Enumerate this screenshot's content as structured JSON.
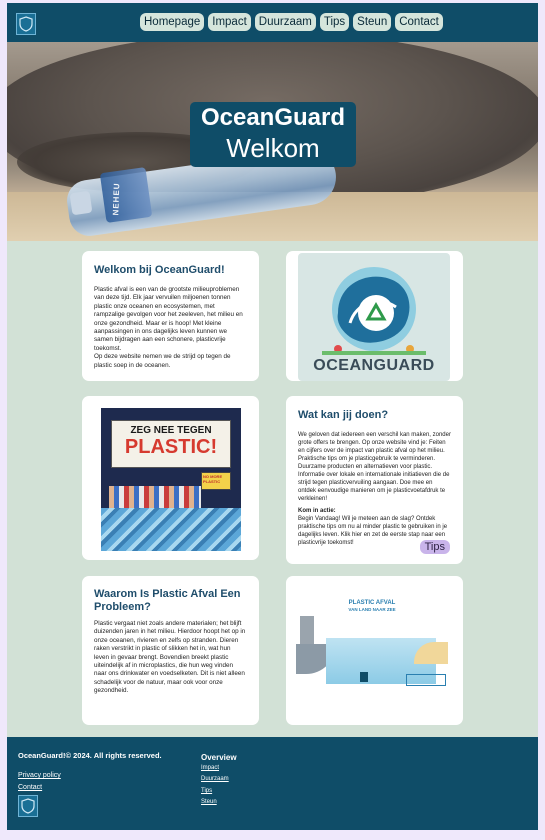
{
  "nav": {
    "logo_icon": "shield-icon",
    "items": [
      "Homepage",
      "Impact",
      "Duurzaam",
      "Tips",
      "Steun",
      "Contact"
    ]
  },
  "hero": {
    "title": "OceanGuard",
    "subtitle": "Welkom",
    "bottle_text": "NEHEU"
  },
  "card1": {
    "title": "Welkom bij OceanGuard!",
    "body": "Plastic afval is een van de grootste milieuproblemen van deze tijd. Elk jaar vervuilen miljoenen tonnen plastic onze oceanen en ecosystemen, met rampzalige gevolgen voor het zeeleven, het milieu en onze gezondheid. Maar er is hoop! Met kleine aanpassingen in ons dagelijks leven kunnen we samen bijdragen aan een schonere, plasticvrije toekomst.",
    "body2": "Op deze website nemen we de strijd op tegen de plastic soep in de oceanen."
  },
  "logo_image": {
    "text": "OCEANGUARD"
  },
  "poster": {
    "line1": "ZEG NEE TEGEN",
    "line2": "PLASTIC!",
    "sign": "NO MORE PLASTIC"
  },
  "card2": {
    "title": "Wat kan jij doen?",
    "body": "We geloven dat iedereen een verschil kan maken, zonder grote offers te brengen. Op onze website vind je: Feiten en cijfers over de impact van plastic afval op het milieu. Praktische tips om je plasticgebruik te verminderen. Duurzame producten en alternatieven voor plastic. Informatie over lokale en internationale initiatieven die de strijd tegen plasticvervuiling aangaan. Doe mee en ontdek eenvoudige manieren om je plasticvoetafdruk te verkleinen!",
    "action_title": "Kom in actie:",
    "action_body": "Begin Vandaag! Wil je meteen aan de slag? Ontdek praktische tips om nu al minder plastic te gebruiken in je dagelijks leven. Klik hier en zet de eerste stap naar een plasticvrije toekomst!",
    "button": "Tips"
  },
  "card3": {
    "title": "Waarom Is Plastic Afval Een Probleem?",
    "body": "Plastic vergaat niet zoals andere materialen; het blijft duizenden jaren in het milieu. Hierdoor hoopt het op in onze oceanen, rivieren en zelfs op stranden. Dieren raken verstrikt in plastic of slikken het in, wat hun leven in gevaar brengt. Bovendien breekt plastic uiteindelijk af in microplastics, die hun weg vinden naar ons drinkwater en voedselketen. Dit is niet alleen schadelijk voor de natuur, maar ook voor onze gezondheid."
  },
  "infographic": {
    "title": "PLASTIC AFVAL",
    "subtitle": "VAN LAND NAAR ZEE"
  },
  "footer": {
    "copyright": "OceanGuard!© 2024. All rights reserved.",
    "privacy": "Privacy policy",
    "contact": "Contact",
    "overview_title": "Overview",
    "overview_links": [
      "Impact",
      "Duurzaam",
      "Tips",
      "Steun"
    ],
    "logo_icon": "shield-icon"
  },
  "colors": {
    "primary": "#0f4d68",
    "background": "#d2e1d6",
    "card": "#ffffff",
    "heading": "#1f4d6b",
    "button": "#c9b4ea"
  }
}
